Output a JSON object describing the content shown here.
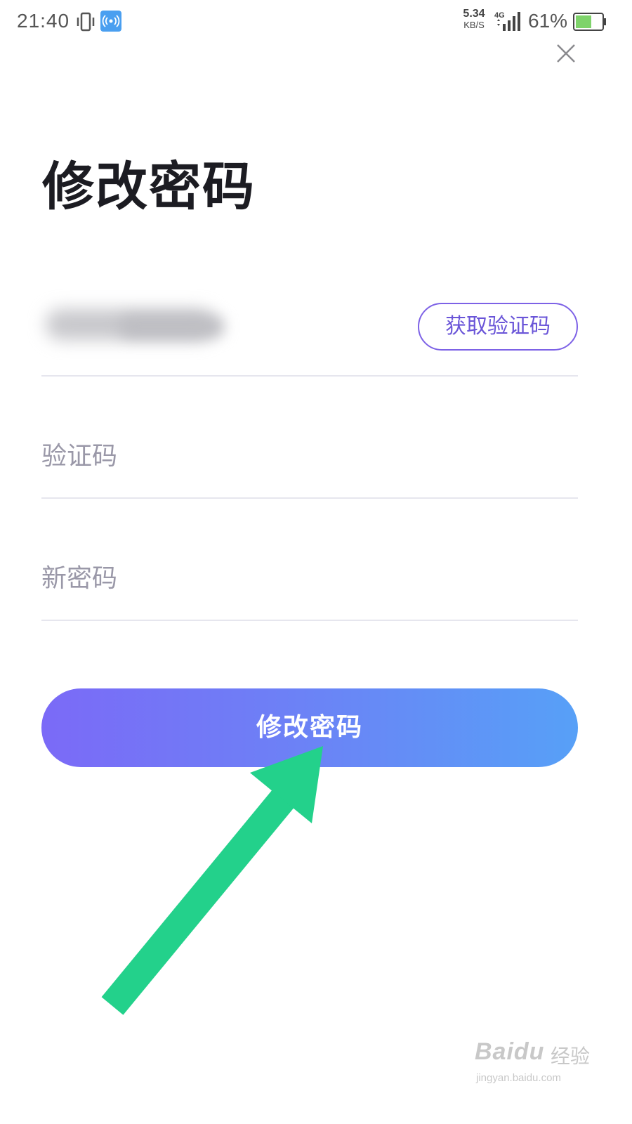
{
  "status_bar": {
    "time": "21:40",
    "net_speed_value": "5.34",
    "net_speed_unit": "KB/S",
    "network_type": "4G",
    "battery_percent": "61%",
    "battery_level": 0.61
  },
  "page": {
    "title": "修改密码"
  },
  "form": {
    "get_code_label": "获取验证码",
    "code_placeholder": "验证码",
    "new_password_placeholder": "新密码",
    "submit_label": "修改密码"
  },
  "colors": {
    "accent": "#7d62e6",
    "gradient_start": "#7b6af7",
    "gradient_end": "#57a0f7",
    "arrow": "#23d18b",
    "hotspot": "#4a9ff0",
    "battery": "#7ed36a"
  },
  "watermark": {
    "brand": "Baidu",
    "brand_suffix": "经验",
    "url": "jingyan.baidu.com"
  }
}
